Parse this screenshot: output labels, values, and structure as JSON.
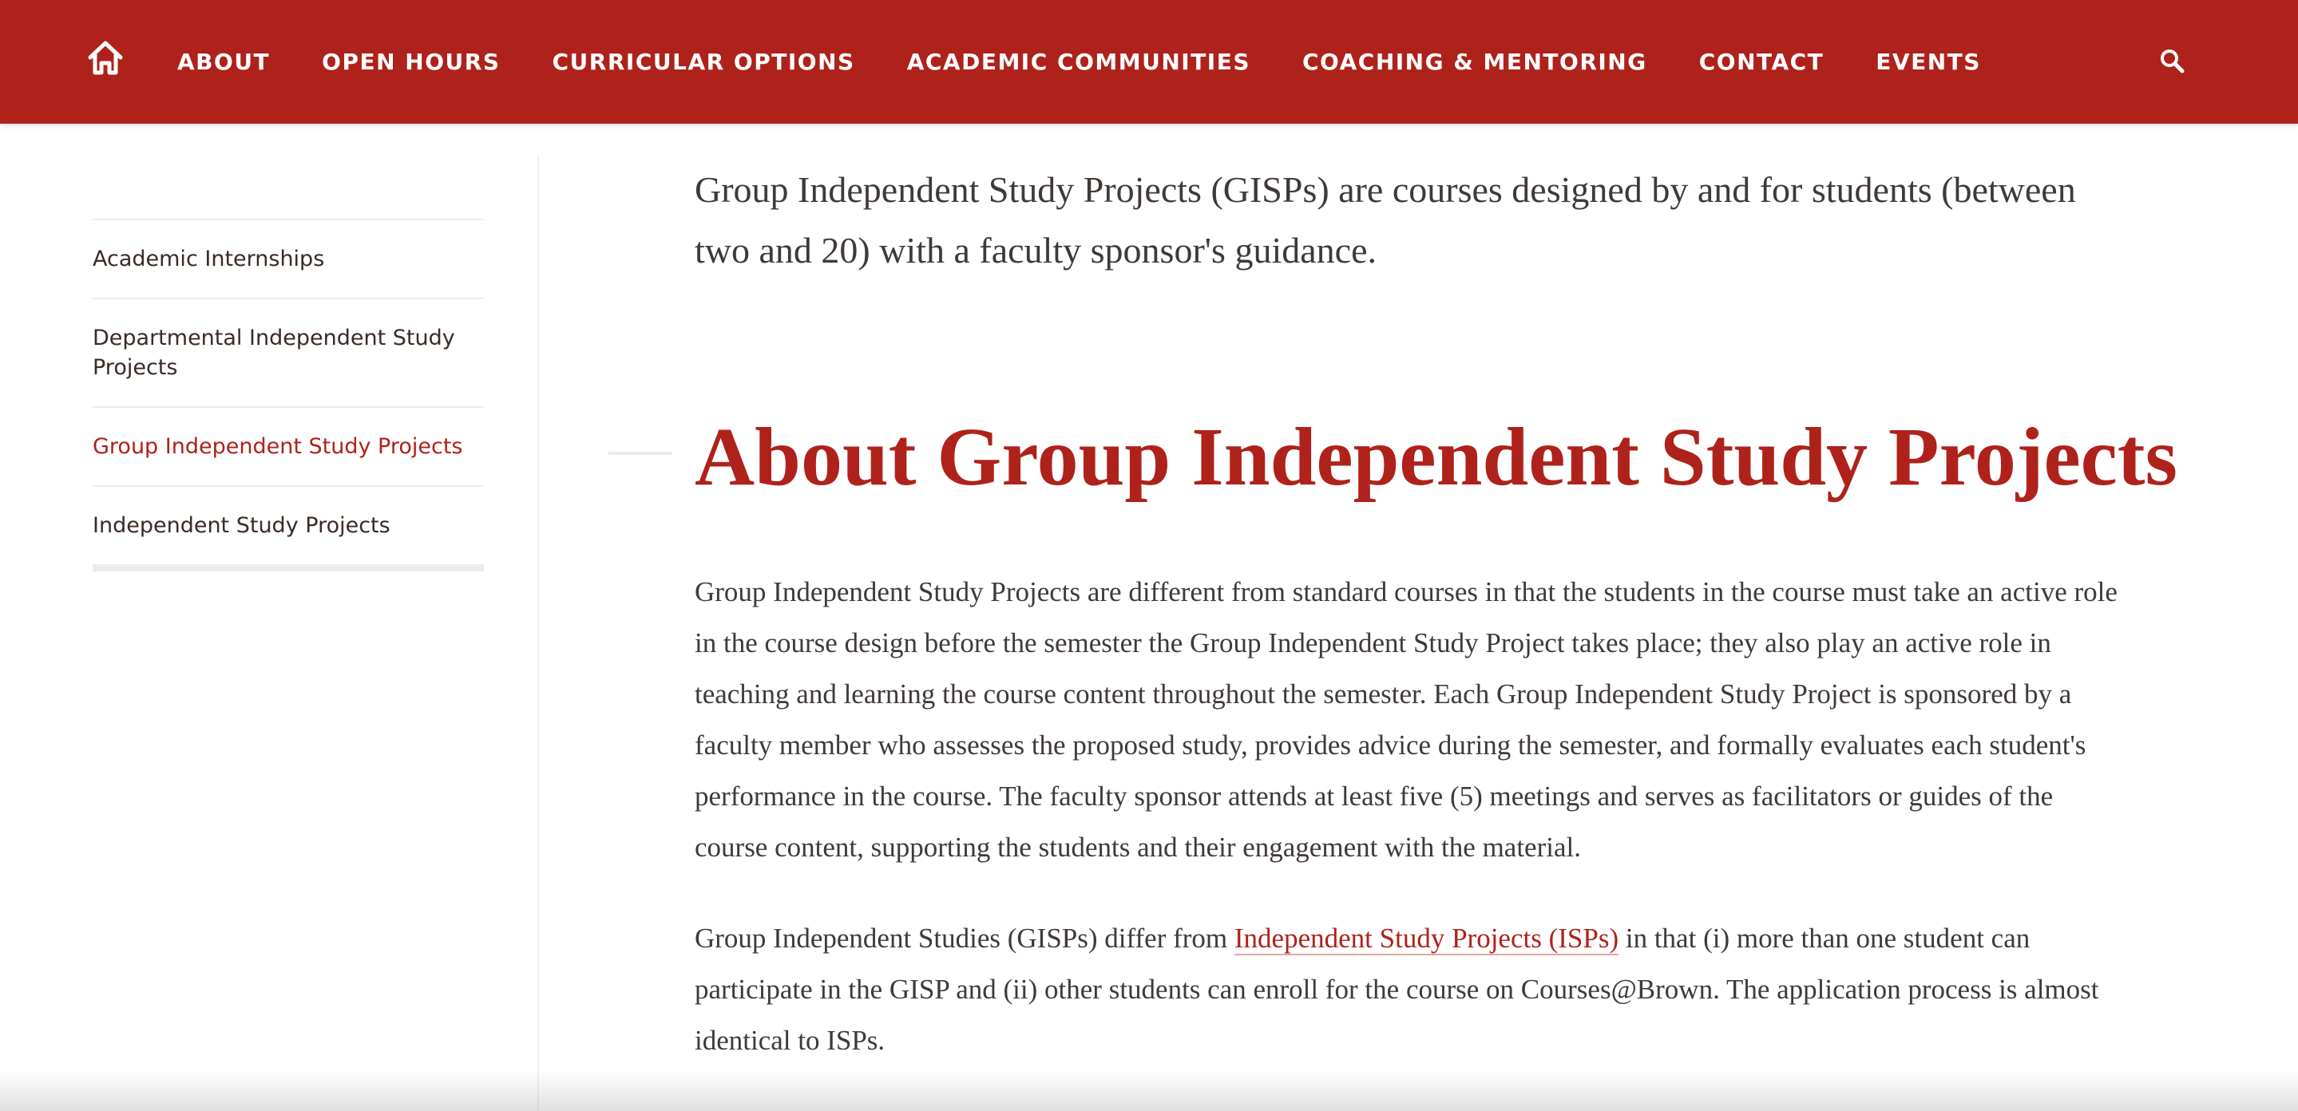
{
  "colors": {
    "brand": "#ae221b",
    "text": "#3f3a37",
    "sidebar_text": "#3b2a26"
  },
  "header": {
    "home_icon": "home-icon",
    "search_icon": "search-icon",
    "nav": [
      "ABOUT",
      "OPEN HOURS",
      "CURRICULAR OPTIONS",
      "ACADEMIC COMMUNITIES",
      "COACHING & MENTORING",
      "CONTACT",
      "EVENTS"
    ]
  },
  "sidebar": {
    "items": [
      {
        "label": "Academic Internships",
        "active": false
      },
      {
        "label": "Departmental Independent Study Projects",
        "active": false
      },
      {
        "label": "Group Independent Study Projects",
        "active": true
      },
      {
        "label": "Independent Study Projects",
        "active": false
      }
    ]
  },
  "main": {
    "lead": "Group Independent Study Projects (GISPs) are courses designed by and for students (between two and 20) with a faculty sponsor's guidance.",
    "heading": "About Group Independent Study Projects",
    "paragraph1": "Group Independent Study Projects are different from standard courses in that the students in the course must take an active role in the course design before the semester the Group Independent Study Project takes place; they also play an active role in teaching and learning the course content throughout the semester. Each Group Independent Study Project is sponsored by a faculty member who assesses the proposed study, provides advice during the semester, and formally evaluates each student's performance in the course. The faculty sponsor attends at least five (5) meetings and serves as facilitators or guides of the course content, supporting the students and their engagement with the material.",
    "paragraph2_before": "Group Independent Studies (GISPs) differ from ",
    "paragraph2_link": "Independent Study Projects (ISPs)",
    "paragraph2_after": " in that (i) more than one student can participate in the GISP and (ii) other students can enroll for the course on Courses@Brown. The application process is almost identical to ISPs."
  }
}
